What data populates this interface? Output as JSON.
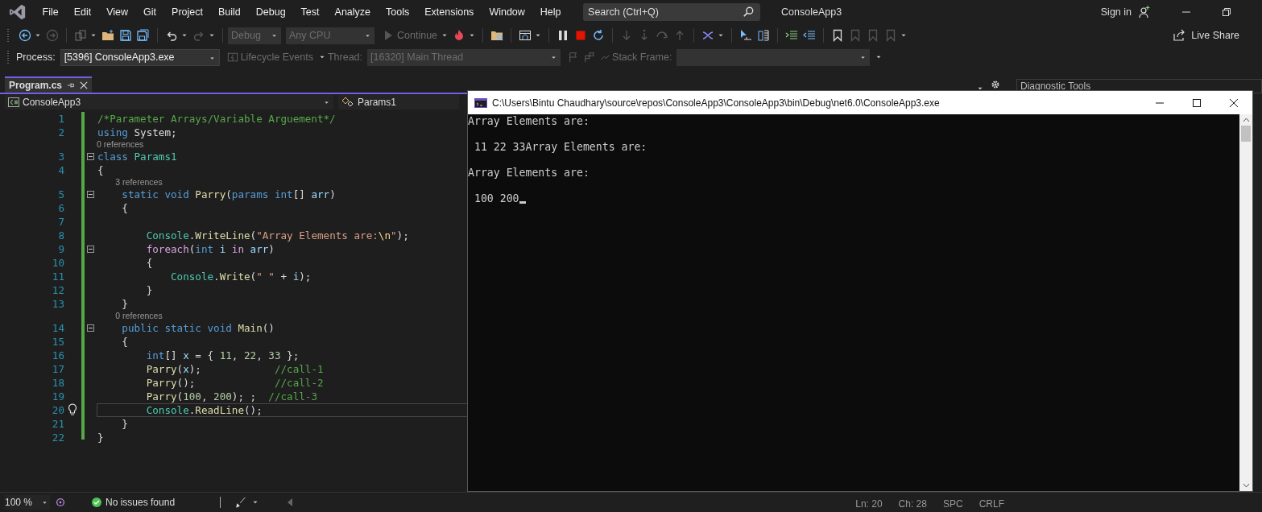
{
  "title_bar": {
    "menu": [
      "File",
      "Edit",
      "View",
      "Git",
      "Project",
      "Build",
      "Debug",
      "Test",
      "Analyze",
      "Tools",
      "Extensions",
      "Window",
      "Help"
    ],
    "search": {
      "placeholder": "Search (Ctrl+Q)"
    },
    "solution": "ConsoleApp3",
    "sign_in": "Sign in"
  },
  "toolbar": {
    "configuration": "Debug",
    "platform": "Any CPU",
    "continue": "Continue",
    "live_share": "Live Share"
  },
  "debug_location": {
    "process_label": "Process:",
    "process": "[5396] ConsoleApp3.exe",
    "lifecycle": "Lifecycle Events",
    "thread_label": "Thread:",
    "thread": "[16320] Main Thread",
    "stack_frame_label": "Stack Frame:"
  },
  "editor": {
    "tab": {
      "title": "Program.cs",
      "selected": true
    },
    "project": "ConsoleApp3",
    "member": "Params1",
    "lines": [
      {
        "kind": "code",
        "number": "1",
        "tokens": [
          {
            "kind": "comment",
            "text": "/*Parameter Arrays/Variable Arguement*/"
          }
        ]
      },
      {
        "kind": "code",
        "number": "2",
        "tokens": [
          {
            "kind": "keyword",
            "text": "using"
          },
          {
            "kind": "plain",
            "text": " System;"
          }
        ]
      },
      {
        "kind": "lens",
        "text": "0 references"
      },
      {
        "kind": "code",
        "number": "3",
        "fold": true,
        "tokens": [
          {
            "kind": "keyword",
            "text": "class"
          },
          {
            "kind": "type",
            "text": " Params1"
          }
        ]
      },
      {
        "kind": "code",
        "number": "4",
        "tokens": [
          {
            "kind": "plain",
            "text": "{"
          }
        ]
      },
      {
        "kind": "lens",
        "text": "3 references"
      },
      {
        "kind": "code",
        "number": "5",
        "fold": true,
        "tokens": [
          {
            "kind": "keyword",
            "text": "    static"
          },
          {
            "kind": "keyword",
            "text": " void"
          },
          {
            "kind": "method",
            "text": " Parry"
          },
          {
            "kind": "plain",
            "text": "("
          },
          {
            "kind": "keyword",
            "text": "params"
          },
          {
            "kind": "keyword",
            "text": " int"
          },
          {
            "kind": "plain",
            "text": "[] "
          },
          {
            "kind": "variable",
            "text": "arr"
          },
          {
            "kind": "plain",
            "text": ")"
          }
        ]
      },
      {
        "kind": "code",
        "number": "6",
        "tokens": [
          {
            "kind": "plain",
            "text": "    {"
          }
        ]
      },
      {
        "kind": "code",
        "number": "7"
      },
      {
        "kind": "code",
        "number": "8",
        "tokens": [
          {
            "kind": "type",
            "text": "        Console"
          },
          {
            "kind": "plain",
            "text": "."
          },
          {
            "kind": "method",
            "text": "WriteLine"
          },
          {
            "kind": "plain",
            "text": "("
          },
          {
            "kind": "string",
            "text": "\"Array Elements are:"
          },
          {
            "kind": "escape",
            "text": "\\n"
          },
          {
            "kind": "string",
            "text": "\""
          },
          {
            "kind": "plain",
            "text": ");"
          }
        ]
      },
      {
        "kind": "code",
        "number": "9",
        "fold": true,
        "tokens": [
          {
            "kind": "control",
            "text": "        foreach"
          },
          {
            "kind": "plain",
            "text": "("
          },
          {
            "kind": "keyword",
            "text": "int"
          },
          {
            "kind": "variable",
            "text": " i"
          },
          {
            "kind": "control",
            "text": " in"
          },
          {
            "kind": "variable",
            "text": " arr"
          },
          {
            "kind": "plain",
            "text": ")"
          }
        ]
      },
      {
        "kind": "code",
        "number": "10",
        "tokens": [
          {
            "kind": "plain",
            "text": "        {"
          }
        ]
      },
      {
        "kind": "code",
        "number": "11",
        "tokens": [
          {
            "kind": "type",
            "text": "            Console"
          },
          {
            "kind": "plain",
            "text": "."
          },
          {
            "kind": "method",
            "text": "Write"
          },
          {
            "kind": "plain",
            "text": "("
          },
          {
            "kind": "string",
            "text": "\" \""
          },
          {
            "kind": "plain",
            "text": " + "
          },
          {
            "kind": "variable",
            "text": "i"
          },
          {
            "kind": "plain",
            "text": ");"
          }
        ]
      },
      {
        "kind": "code",
        "number": "12",
        "tokens": [
          {
            "kind": "plain",
            "text": "        }"
          }
        ]
      },
      {
        "kind": "code",
        "number": "13",
        "tokens": [
          {
            "kind": "plain",
            "text": "    }"
          }
        ]
      },
      {
        "kind": "lens",
        "text": "0 references"
      },
      {
        "kind": "code",
        "number": "14",
        "fold": true,
        "tokens": [
          {
            "kind": "keyword",
            "text": "    public"
          },
          {
            "kind": "keyword",
            "text": " static"
          },
          {
            "kind": "keyword",
            "text": " void"
          },
          {
            "kind": "method",
            "text": " Main"
          },
          {
            "kind": "plain",
            "text": "()"
          }
        ]
      },
      {
        "kind": "code",
        "number": "15",
        "tokens": [
          {
            "kind": "plain",
            "text": "    {"
          }
        ]
      },
      {
        "kind": "code",
        "number": "16",
        "tokens": [
          {
            "kind": "keyword",
            "text": "        int"
          },
          {
            "kind": "plain",
            "text": "[] "
          },
          {
            "kind": "variable",
            "text": "x"
          },
          {
            "kind": "plain",
            "text": " = { "
          },
          {
            "kind": "number",
            "text": "11"
          },
          {
            "kind": "plain",
            "text": ", "
          },
          {
            "kind": "number",
            "text": "22"
          },
          {
            "kind": "plain",
            "text": ", "
          },
          {
            "kind": "number",
            "text": "33"
          },
          {
            "kind": "plain",
            "text": " };"
          }
        ]
      },
      {
        "kind": "code",
        "number": "17",
        "tokens": [
          {
            "kind": "method",
            "text": "        Parry"
          },
          {
            "kind": "plain",
            "text": "("
          },
          {
            "kind": "variable",
            "text": "x"
          },
          {
            "kind": "plain",
            "text": ");            "
          },
          {
            "kind": "comment",
            "text": "//call-1"
          }
        ]
      },
      {
        "kind": "code",
        "number": "18",
        "tokens": [
          {
            "kind": "method",
            "text": "        Parry"
          },
          {
            "kind": "plain",
            "text": "();             "
          },
          {
            "kind": "comment",
            "text": "//call-2"
          }
        ]
      },
      {
        "kind": "code",
        "number": "19",
        "tokens": [
          {
            "kind": "method",
            "text": "        Parry"
          },
          {
            "kind": "plain",
            "text": "("
          },
          {
            "kind": "number",
            "text": "100"
          },
          {
            "kind": "plain",
            "text": ", "
          },
          {
            "kind": "number",
            "text": "200"
          },
          {
            "kind": "plain",
            "text": "); ;  "
          },
          {
            "kind": "comment",
            "text": "//call-3"
          }
        ]
      },
      {
        "kind": "code",
        "number": "20",
        "current": true,
        "lightbulb": true,
        "tokens": [
          {
            "kind": "type",
            "text": "        Console"
          },
          {
            "kind": "plain",
            "text": "."
          },
          {
            "kind": "method",
            "text": "ReadLine"
          },
          {
            "kind": "plain",
            "text": "();"
          }
        ]
      },
      {
        "kind": "code",
        "number": "21",
        "tokens": [
          {
            "kind": "plain",
            "text": "    }"
          }
        ]
      },
      {
        "kind": "code",
        "number": "22",
        "tokens": [
          {
            "kind": "plain",
            "text": "}"
          }
        ]
      }
    ]
  },
  "diagnostic_tools": {
    "title": "Diagnostic Tools"
  },
  "console": {
    "title": "C:\\Users\\Bintu Chaudhary\\source\\repos\\ConsoleApp3\\ConsoleApp3\\bin\\Debug\\net6.0\\ConsoleApp3.exe",
    "output": [
      "Array Elements are:",
      " 11 22 33Array Elements are:",
      "Array Elements are:",
      " 100 200"
    ]
  },
  "status_bar": {
    "zoom": "100 %",
    "issues": "No issues found",
    "line": "Ln: 20",
    "column": "Ch: 28",
    "whitespace": "SPC",
    "line_ending": "CRLF"
  }
}
